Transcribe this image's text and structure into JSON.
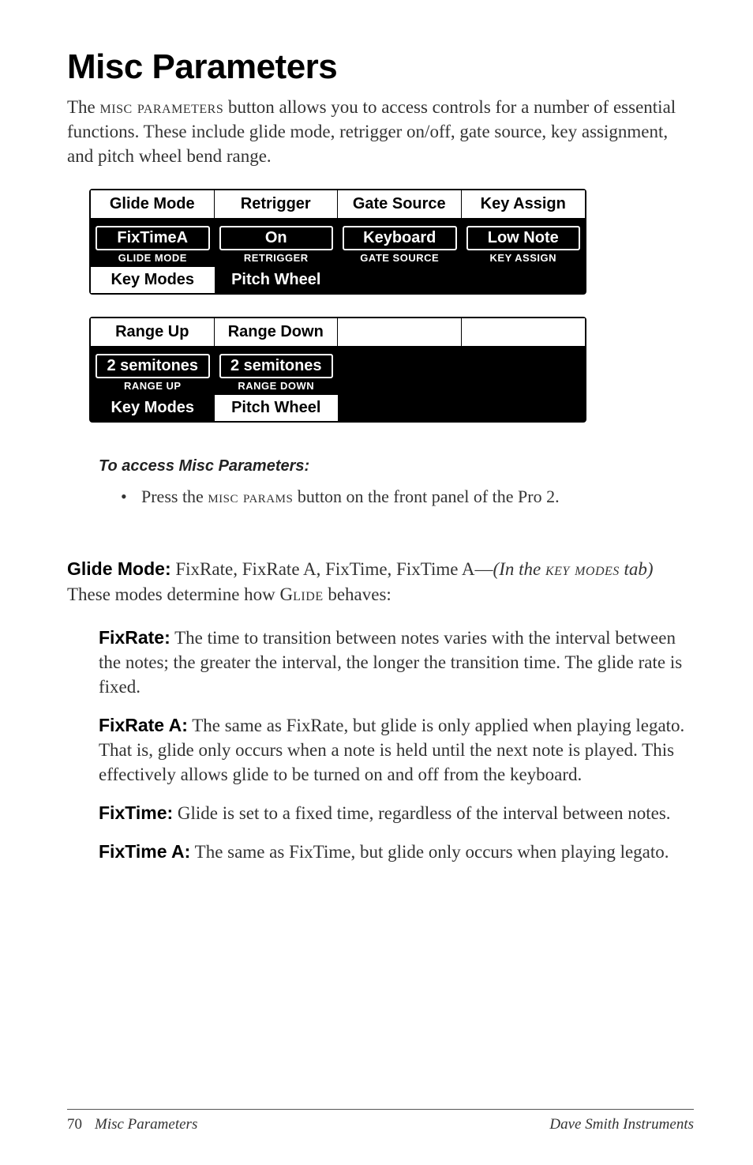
{
  "title": "Misc Parameters",
  "intro_sc_1": "misc parameters",
  "intro_rest": " button allows you to access controls for a number of essential functions. These include glide mode, retrigger on/off, gate source, key assignment, and pitch wheel bend range.",
  "panel1": {
    "headers": {
      "c1": "Glide Mode",
      "c2": "Retrigger",
      "c3": "Gate Source",
      "c4": "Key Assign"
    },
    "values": {
      "c1": {
        "val": "FixTimeA",
        "label": "GLIDE MODE"
      },
      "c2": {
        "val": "On",
        "label": "RETRIGGER"
      },
      "c3": {
        "val": "Keyboard",
        "label": "GATE SOURCE"
      },
      "c4": {
        "val": "Low Note",
        "label": "KEY ASSIGN"
      }
    },
    "tabs": {
      "t1": "Key Modes",
      "t2": "Pitch Wheel"
    }
  },
  "panel2": {
    "headers": {
      "c1": "Range Up",
      "c2": "Range Down"
    },
    "values": {
      "c1": {
        "val": "2 semitones",
        "label": "RANGE UP"
      },
      "c2": {
        "val": "2 semitones",
        "label": "RANGE DOWN"
      }
    },
    "tabs": {
      "t1": "Key Modes",
      "t2": "Pitch Wheel"
    }
  },
  "access_heading": "To access Misc Parameters:",
  "bullet_pre": "Press the ",
  "bullet_sc": "misc params",
  "bullet_post": " button on the front panel of the Pro 2.",
  "def_lead": {
    "name": "Glide Mode:",
    "vals": " FixRate, FixRate A, FixTime, FixTime A—",
    "italic_pre": "(In the ",
    "italic_sc": "key modes",
    "italic_post": " tab)",
    "tail": " These modes determine how G",
    "tail_sc": "lide",
    "tail2": " behaves:"
  },
  "fixrate": {
    "name": "FixRate:",
    "body": " The time to transition between notes varies with the interval between the notes; the greater the interval, the longer the transition time. The glide rate is fixed."
  },
  "fixrate_a": {
    "name": "FixRate A:",
    "body": " The same as FixRate, but glide is only applied when playing legato. That is, glide only occurs when a note is held until the next note is played. This effectively allows glide to be turned on and off from the keyboard."
  },
  "fixtime": {
    "name": "FixTime:",
    "body": " Glide is set to a fixed time, regardless of the interval between notes."
  },
  "fixtime_a": {
    "name": "FixTime A:",
    "body": " The same as FixTime, but glide only occurs when playing legato."
  },
  "footer": {
    "page": "70",
    "section": "Misc Parameters",
    "right": "Dave Smith Instruments"
  }
}
